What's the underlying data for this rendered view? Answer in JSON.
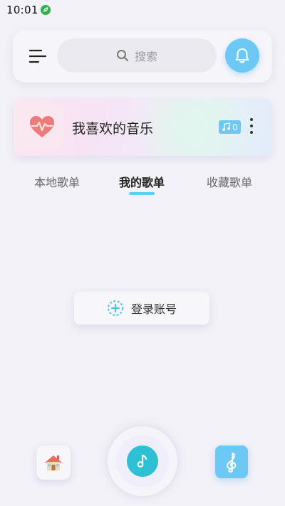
{
  "status_bar": {
    "time": "10:01",
    "app_icon": "green-leaf-icon"
  },
  "header": {
    "menu_icon": "menu-icon",
    "search": {
      "placeholder": "搜索",
      "icon": "search-icon"
    },
    "bell_icon": "bell-icon"
  },
  "favorites": {
    "title": "我喜欢的音乐",
    "icon": "heart-pulse-icon",
    "song_count": "0",
    "badge_icon": "music-note-icon",
    "more_icon": "more-vertical-icon"
  },
  "tabs": [
    {
      "label": "本地歌单",
      "active": false
    },
    {
      "label": "我的歌单",
      "active": true
    },
    {
      "label": "收藏歌单",
      "active": false
    }
  ],
  "login": {
    "label": "登录账号",
    "icon": "add-circle-icon"
  },
  "bottom_nav": {
    "home_icon": "house-icon",
    "play_icon": "music-note-icon",
    "treble_icon": "treble-clef-icon"
  },
  "colors": {
    "accent": "#6cc8f5",
    "play": "#2ec0d4",
    "heart": "#ee7b7b",
    "background": "#f3f2f8"
  }
}
